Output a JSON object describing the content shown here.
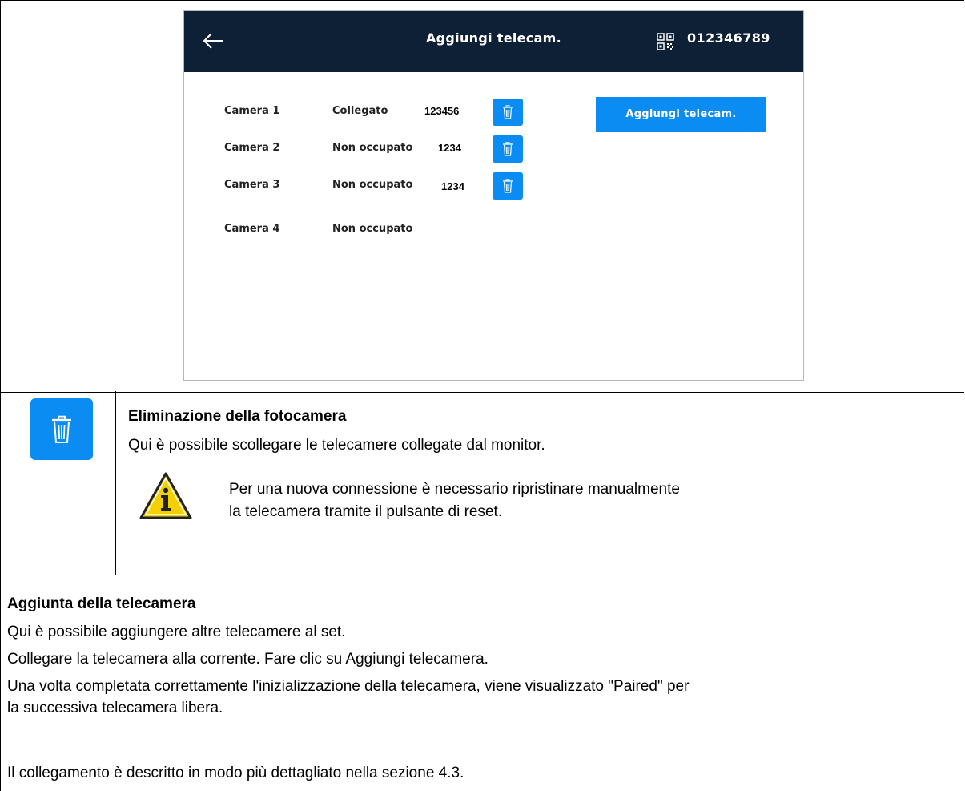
{
  "device": {
    "title": "Aggiungi telecam.",
    "device_id": "012346789",
    "add_button_label": "Aggiungi telecam.",
    "cameras": [
      {
        "name": "Camera 1",
        "status": "Collegato",
        "code": "123456",
        "deletable": true
      },
      {
        "name": "Camera 2",
        "status": "Non occupato",
        "code": "1234",
        "deletable": true
      },
      {
        "name": "Camera 3",
        "status": "Non occupato",
        "code": "1234",
        "deletable": true
      },
      {
        "name": "Camera 4",
        "status": "Non occupato",
        "code": "",
        "deletable": false
      }
    ],
    "icons": {
      "back": "back-arrow-icon",
      "qr": "qr-code-icon",
      "trash": "trash-icon"
    },
    "colors": {
      "header_bg": "#0e2036",
      "accent": "#0a8cf2"
    }
  },
  "delete_section": {
    "title": "Eliminazione della fotocamera",
    "body": "Qui è possibile scollegare le telecamere collegate dal monitor.",
    "note_line1": "Per una nuova connessione è necessario ripristinare manualmente",
    "note_line2": "la telecamera tramite il pulsante di reset.",
    "icons": {
      "trash": "trash-icon",
      "warning": "info-warning-icon"
    }
  },
  "add_section": {
    "title": "Aggiunta della telecamera",
    "line1": "Qui è possibile aggiungere altre telecamere al set.",
    "line2": "Collegare la telecamera alla corrente. Fare clic su Aggiungi telecamera.",
    "line3a": "Una volta completata correttamente l'inizializzazione della telecamera, viene visualizzato \"Paired\" per",
    "line3b": "la successiva telecamera libera.",
    "line4": "Il collegamento è descritto in modo più dettagliato nella sezione 4.3."
  }
}
